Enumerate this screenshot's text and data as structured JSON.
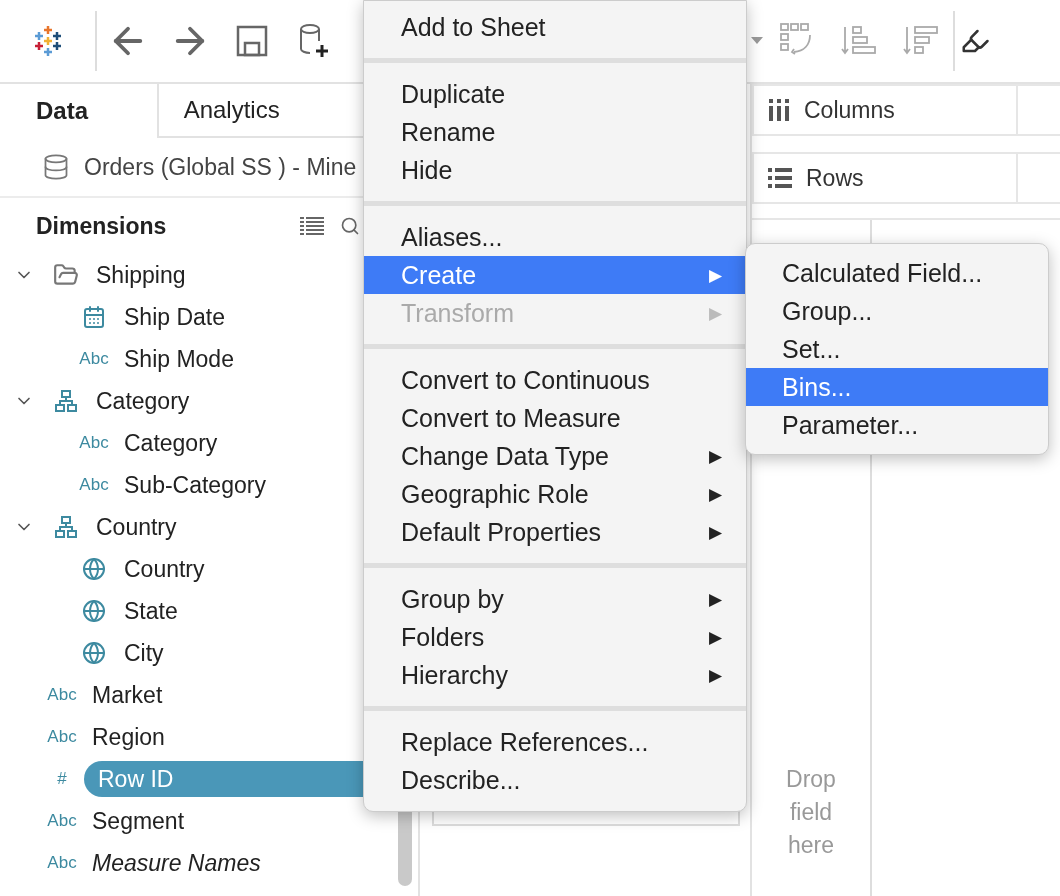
{
  "toolbar": {
    "buttons": [
      {
        "kind": "logo"
      },
      {
        "kind": "back"
      },
      {
        "kind": "forward"
      },
      {
        "kind": "save"
      },
      {
        "kind": "new-data"
      },
      {
        "kind": "caret"
      },
      {
        "kind": "swap"
      },
      {
        "kind": "sort-asc"
      },
      {
        "kind": "sort-desc"
      },
      {
        "kind": "highlight"
      }
    ]
  },
  "side_tabs": [
    {
      "label": "Data",
      "selected": true
    },
    {
      "label": "Analytics",
      "selected": false
    }
  ],
  "data_source": "Orders (Global SS ) - Mine",
  "dimensions": {
    "title": "Dimensions",
    "items": [
      {
        "label": "Shipping",
        "kind": "folder",
        "expanded": true,
        "children": [
          {
            "label": "Ship Date",
            "kind": "date"
          },
          {
            "label": "Ship Mode",
            "kind": "string",
            "type_label": "Abc"
          }
        ]
      },
      {
        "label": "Category",
        "kind": "hierarchy",
        "expanded": true,
        "children": [
          {
            "label": "Category",
            "kind": "string",
            "type_label": "Abc"
          },
          {
            "label": "Sub-Category",
            "kind": "string",
            "type_label": "Abc"
          }
        ]
      },
      {
        "label": "Country",
        "kind": "hierarchy",
        "expanded": true,
        "children": [
          {
            "label": "Country",
            "kind": "geo"
          },
          {
            "label": "State",
            "kind": "geo"
          },
          {
            "label": "City",
            "kind": "geo"
          }
        ]
      },
      {
        "label": "Market",
        "kind": "string",
        "type_label": "Abc"
      },
      {
        "label": "Region",
        "kind": "string",
        "type_label": "Abc"
      },
      {
        "label": "Row ID",
        "kind": "number",
        "type_label": "#",
        "selected": true
      },
      {
        "label": "Segment",
        "kind": "string",
        "type_label": "Abc"
      },
      {
        "label": "Measure Names",
        "kind": "string",
        "type_label": "Abc",
        "italic": true
      }
    ]
  },
  "shelves": [
    {
      "label": "Columns",
      "kind": "columns"
    },
    {
      "label": "Rows",
      "kind": "rows"
    }
  ],
  "drop_hint": "Drop\nfield\nhere",
  "context_menu": {
    "sections": [
      [
        {
          "label": "Add to Sheet"
        }
      ],
      [
        {
          "label": "Duplicate"
        },
        {
          "label": "Rename"
        },
        {
          "label": "Hide"
        }
      ],
      [
        {
          "label": "Aliases..."
        },
        {
          "label": "Create",
          "submenu": true,
          "selected": true
        },
        {
          "label": "Transform",
          "submenu": true,
          "disabled": true
        }
      ],
      [
        {
          "label": "Convert to Continuous"
        },
        {
          "label": "Convert to Measure"
        },
        {
          "label": "Change Data Type",
          "submenu": true
        },
        {
          "label": "Geographic Role",
          "submenu": true
        },
        {
          "label": "Default Properties",
          "submenu": true
        }
      ],
      [
        {
          "label": "Group by",
          "submenu": true
        },
        {
          "label": "Folders",
          "submenu": true
        },
        {
          "label": "Hierarchy",
          "submenu": true
        }
      ],
      [
        {
          "label": "Replace References..."
        },
        {
          "label": "Describe..."
        }
      ]
    ],
    "arrow": "▶",
    "submenu": [
      {
        "label": "Calculated Field...",
        "selected": false
      },
      {
        "label": "Group...",
        "selected": false
      },
      {
        "label": "Set...",
        "selected": false
      },
      {
        "label": "Bins...",
        "selected": true
      },
      {
        "label": "Parameter...",
        "selected": false
      }
    ]
  }
}
